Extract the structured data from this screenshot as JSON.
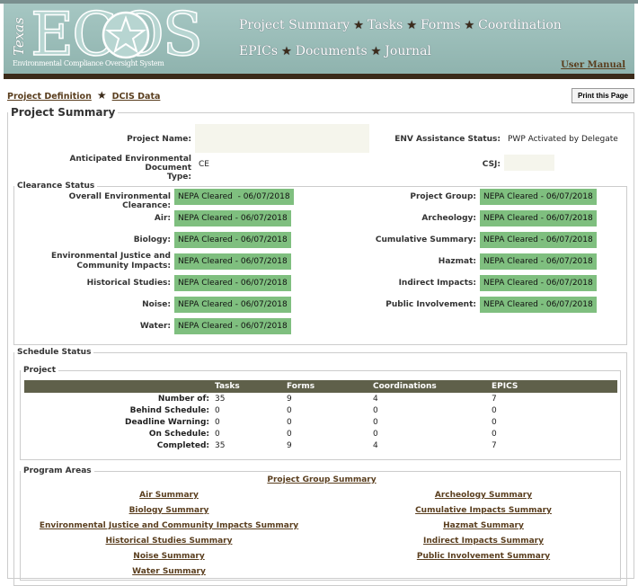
{
  "header": {
    "logo_texas": "Texas",
    "logo_ecos": "ECOS",
    "logo_subtitle": "Environmental Compliance Oversight System",
    "nav": [
      "Project Summary",
      "Tasks",
      "Forms",
      "Coordination",
      "EPICs",
      "Documents",
      "Journal"
    ],
    "user_manual": "User Manual"
  },
  "subnav": {
    "project_definition": "Project Definition",
    "dcis_data": "DCIS Data",
    "print": "Print this Page"
  },
  "project_summary": {
    "legend": "Project Summary",
    "project_name_label": "Project Name:",
    "project_name_value": "",
    "env_assist_label": "ENV Assistance Status:",
    "env_assist_value": "PWP Activated by Delegate",
    "anticipated_label_1": "Anticipated Environmental Document",
    "anticipated_label_2": "Type:",
    "anticipated_value": "CE",
    "csj_label": "CSJ:",
    "csj_value": ""
  },
  "clearance": {
    "legend": "Clearance Status",
    "left": [
      {
        "label": "Overall Environmental Clearance:",
        "value": "NEPA Cleared  - 06/07/2018"
      },
      {
        "label": "Air:",
        "value": "NEPA Cleared - 06/07/2018"
      },
      {
        "label": "Biology:",
        "value": "NEPA Cleared - 06/07/2018"
      },
      {
        "label": "Environmental Justice and\nCommunity Impacts:",
        "value": "NEPA Cleared - 06/07/2018"
      },
      {
        "label": "Historical Studies:",
        "value": "NEPA Cleared - 06/07/2018"
      },
      {
        "label": "Noise:",
        "value": "NEPA Cleared - 06/07/2018"
      },
      {
        "label": "Water:",
        "value": "NEPA Cleared - 06/07/2018"
      }
    ],
    "right": [
      {
        "label": "Project Group:",
        "value": "NEPA Cleared - 06/07/2018"
      },
      {
        "label": "Archeology:",
        "value": "NEPA Cleared - 06/07/2018"
      },
      {
        "label": "Cumulative Summary:",
        "value": "NEPA Cleared - 06/07/2018"
      },
      {
        "label": "Hazmat:",
        "value": "NEPA Cleared - 06/07/2018"
      },
      {
        "label": "Indirect Impacts:",
        "value": "NEPA Cleared - 06/07/2018"
      },
      {
        "label": "Public Involvement:",
        "value": "NEPA Cleared - 06/07/2018"
      }
    ]
  },
  "schedule": {
    "legend": "Schedule Status",
    "project_legend": "Project",
    "columns": [
      "Tasks",
      "Forms",
      "Coordinations",
      "EPICS"
    ],
    "rows": [
      {
        "label": "Number of:",
        "values": [
          "35",
          "9",
          "4",
          "7"
        ]
      },
      {
        "label": "Behind Schedule:",
        "values": [
          "0",
          "0",
          "0",
          "0"
        ]
      },
      {
        "label": "Deadline Warning:",
        "values": [
          "0",
          "0",
          "0",
          "0"
        ]
      },
      {
        "label": "On Schedule:",
        "values": [
          "0",
          "0",
          "0",
          "0"
        ]
      },
      {
        "label": "Completed:",
        "values": [
          "35",
          "9",
          "4",
          "7"
        ]
      }
    ]
  },
  "program_areas": {
    "legend": "Program Areas",
    "project_group": "Project Group Summary",
    "left": [
      "Air Summary",
      "Biology Summary",
      "Environmental Justice and Community Impacts Summary",
      "Historical Studies Summary",
      "Noise Summary",
      "Water Summary"
    ],
    "right": [
      "Archeology Summary",
      "Cumulative Impacts Summary",
      "Hazmat Summary",
      "Indirect Impacts Summary",
      "Public Involvement Summary"
    ]
  },
  "colors": {
    "cleared_green": "#7fbf7f",
    "table_header": "#5f604a",
    "banner": "#a6c7c3",
    "link": "#5a3e1e"
  }
}
